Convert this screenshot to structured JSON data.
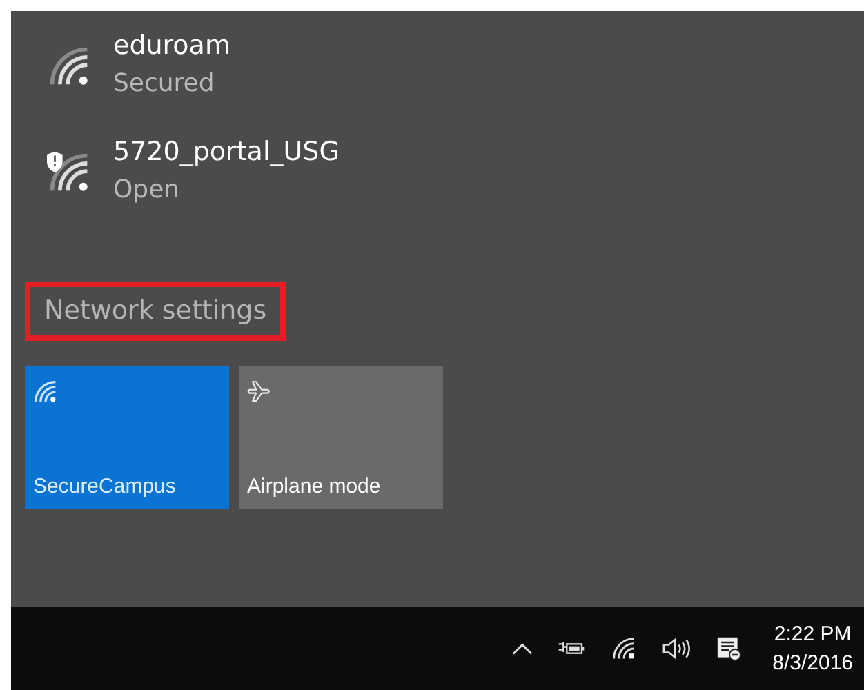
{
  "networks": [
    {
      "name": "eduroam",
      "status": "Secured",
      "warning": false
    },
    {
      "name": "5720_portal_USG",
      "status": "Open",
      "warning": true
    }
  ],
  "settings_link": {
    "label": "Network settings",
    "highlighted": true
  },
  "tiles": [
    {
      "label": "SecureCampus",
      "kind": "wifi",
      "on": true
    },
    {
      "label": "Airplane mode",
      "kind": "airplane",
      "on": false
    }
  ],
  "taskbar": {
    "time": "2:22 PM",
    "date": "8/3/2016"
  }
}
